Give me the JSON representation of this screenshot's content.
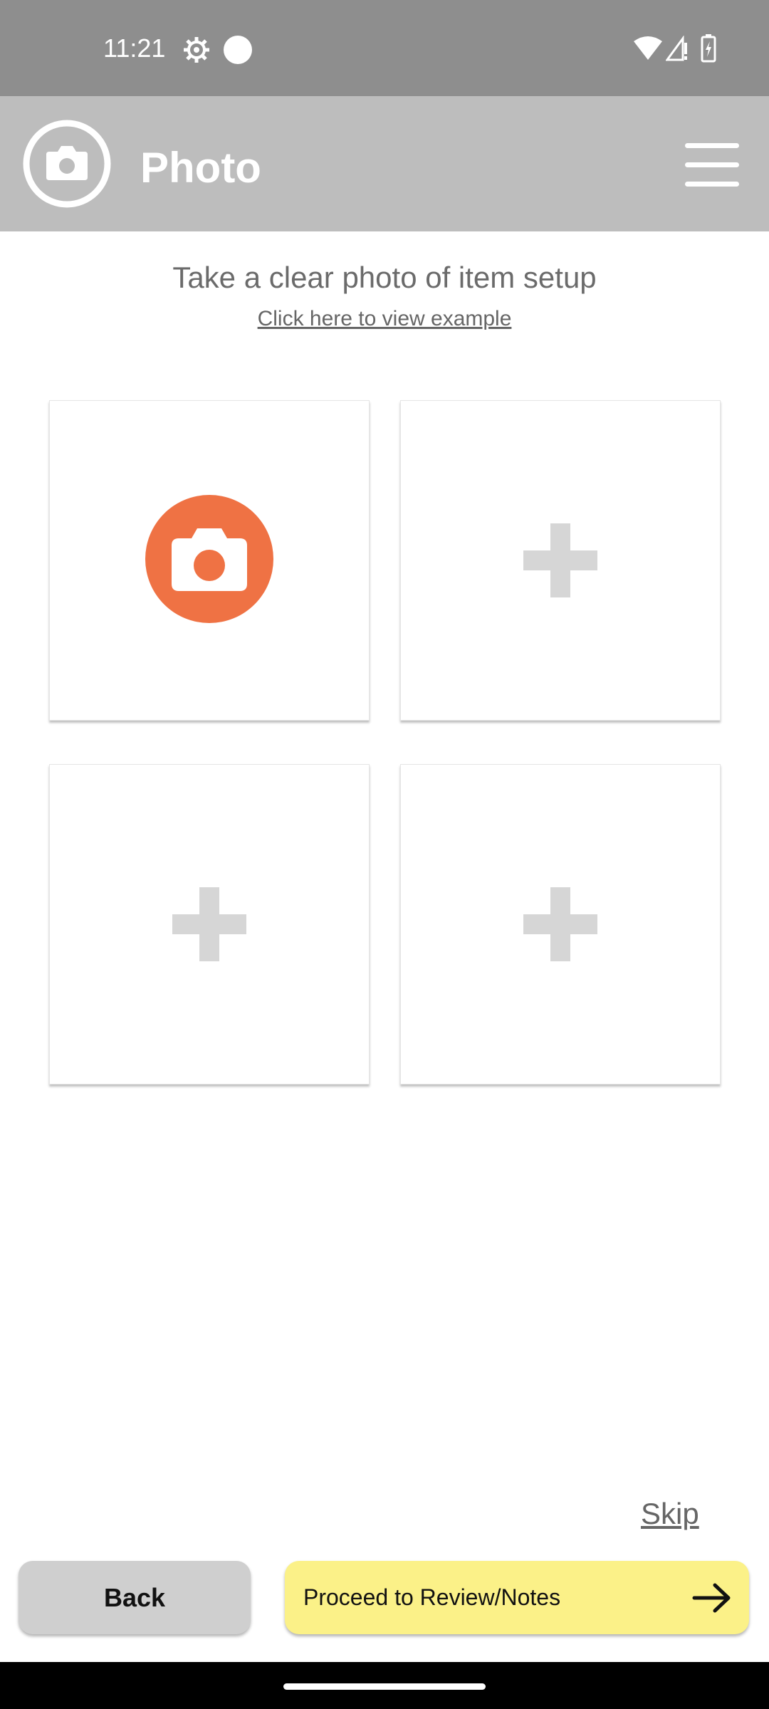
{
  "status_bar": {
    "time": "11:21",
    "icons": [
      "gear-icon",
      "dot-icon",
      "wifi-icon",
      "signal-icon",
      "battery-icon"
    ]
  },
  "app_bar": {
    "title": "Photo",
    "logo_icon": "camera-icon",
    "menu_icon": "menu-icon"
  },
  "instructions": {
    "heading": "Take a clear photo of item setup",
    "example_link": "Click here to view example"
  },
  "photo_grid": {
    "tiles": [
      {
        "state": "capture",
        "icon": "camera-icon"
      },
      {
        "state": "empty",
        "icon": "plus-icon"
      },
      {
        "state": "empty",
        "icon": "plus-icon"
      },
      {
        "state": "empty",
        "icon": "plus-icon"
      }
    ]
  },
  "footer": {
    "skip_label": "Skip",
    "back_label": "Back",
    "proceed_label": "Proceed to Review/Notes",
    "proceed_icon": "arrow-right-icon"
  },
  "colors": {
    "status_bar": "#8e8e8e",
    "app_bar": "#bdbdbd",
    "camera_accent": "#ef7244",
    "plus_icon": "#d6d6d6",
    "back_button": "#cfcfcf",
    "proceed_button": "#fbf188"
  }
}
